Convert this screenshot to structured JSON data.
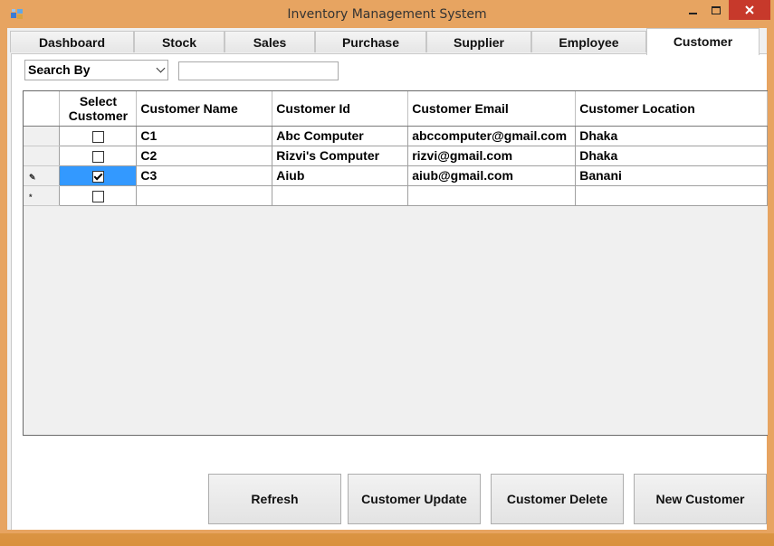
{
  "window": {
    "title": "Inventory Management System"
  },
  "tabs": [
    {
      "label": "Dashboard"
    },
    {
      "label": "Stock"
    },
    {
      "label": "Sales"
    },
    {
      "label": "Purchase"
    },
    {
      "label": "Supplier"
    },
    {
      "label": "Employee"
    },
    {
      "label": "Customer",
      "active": true
    }
  ],
  "search": {
    "by_label": "Search By",
    "query": ""
  },
  "grid": {
    "columns": [
      "Select Customer",
      "Customer Name",
      "Customer Id",
      "Customer Email",
      "Customer Location"
    ],
    "rows": [
      {
        "checked": false,
        "name": "C1",
        "id": "Abc Computer",
        "email": "abccomputer@gmail.com",
        "location": "Dhaka"
      },
      {
        "checked": false,
        "name": "C2",
        "id": "Rizvi's Computer",
        "email": "rizvi@gmail.com",
        "location": "Dhaka"
      },
      {
        "checked": true,
        "name": "C3",
        "id": "Aiub",
        "email": "aiub@gmail.com",
        "location": "Banani",
        "editing": true
      },
      {
        "checked": false,
        "name": "",
        "id": "",
        "email": "",
        "location": "",
        "new_row": true
      }
    ]
  },
  "buttons": {
    "refresh": "Refresh",
    "update": "Customer Update",
    "delete": "Customer Delete",
    "new": "New Customer"
  },
  "colors": {
    "title_bar": "#e7a461",
    "close_button": "#c7392b",
    "selection": "#3399ff"
  }
}
